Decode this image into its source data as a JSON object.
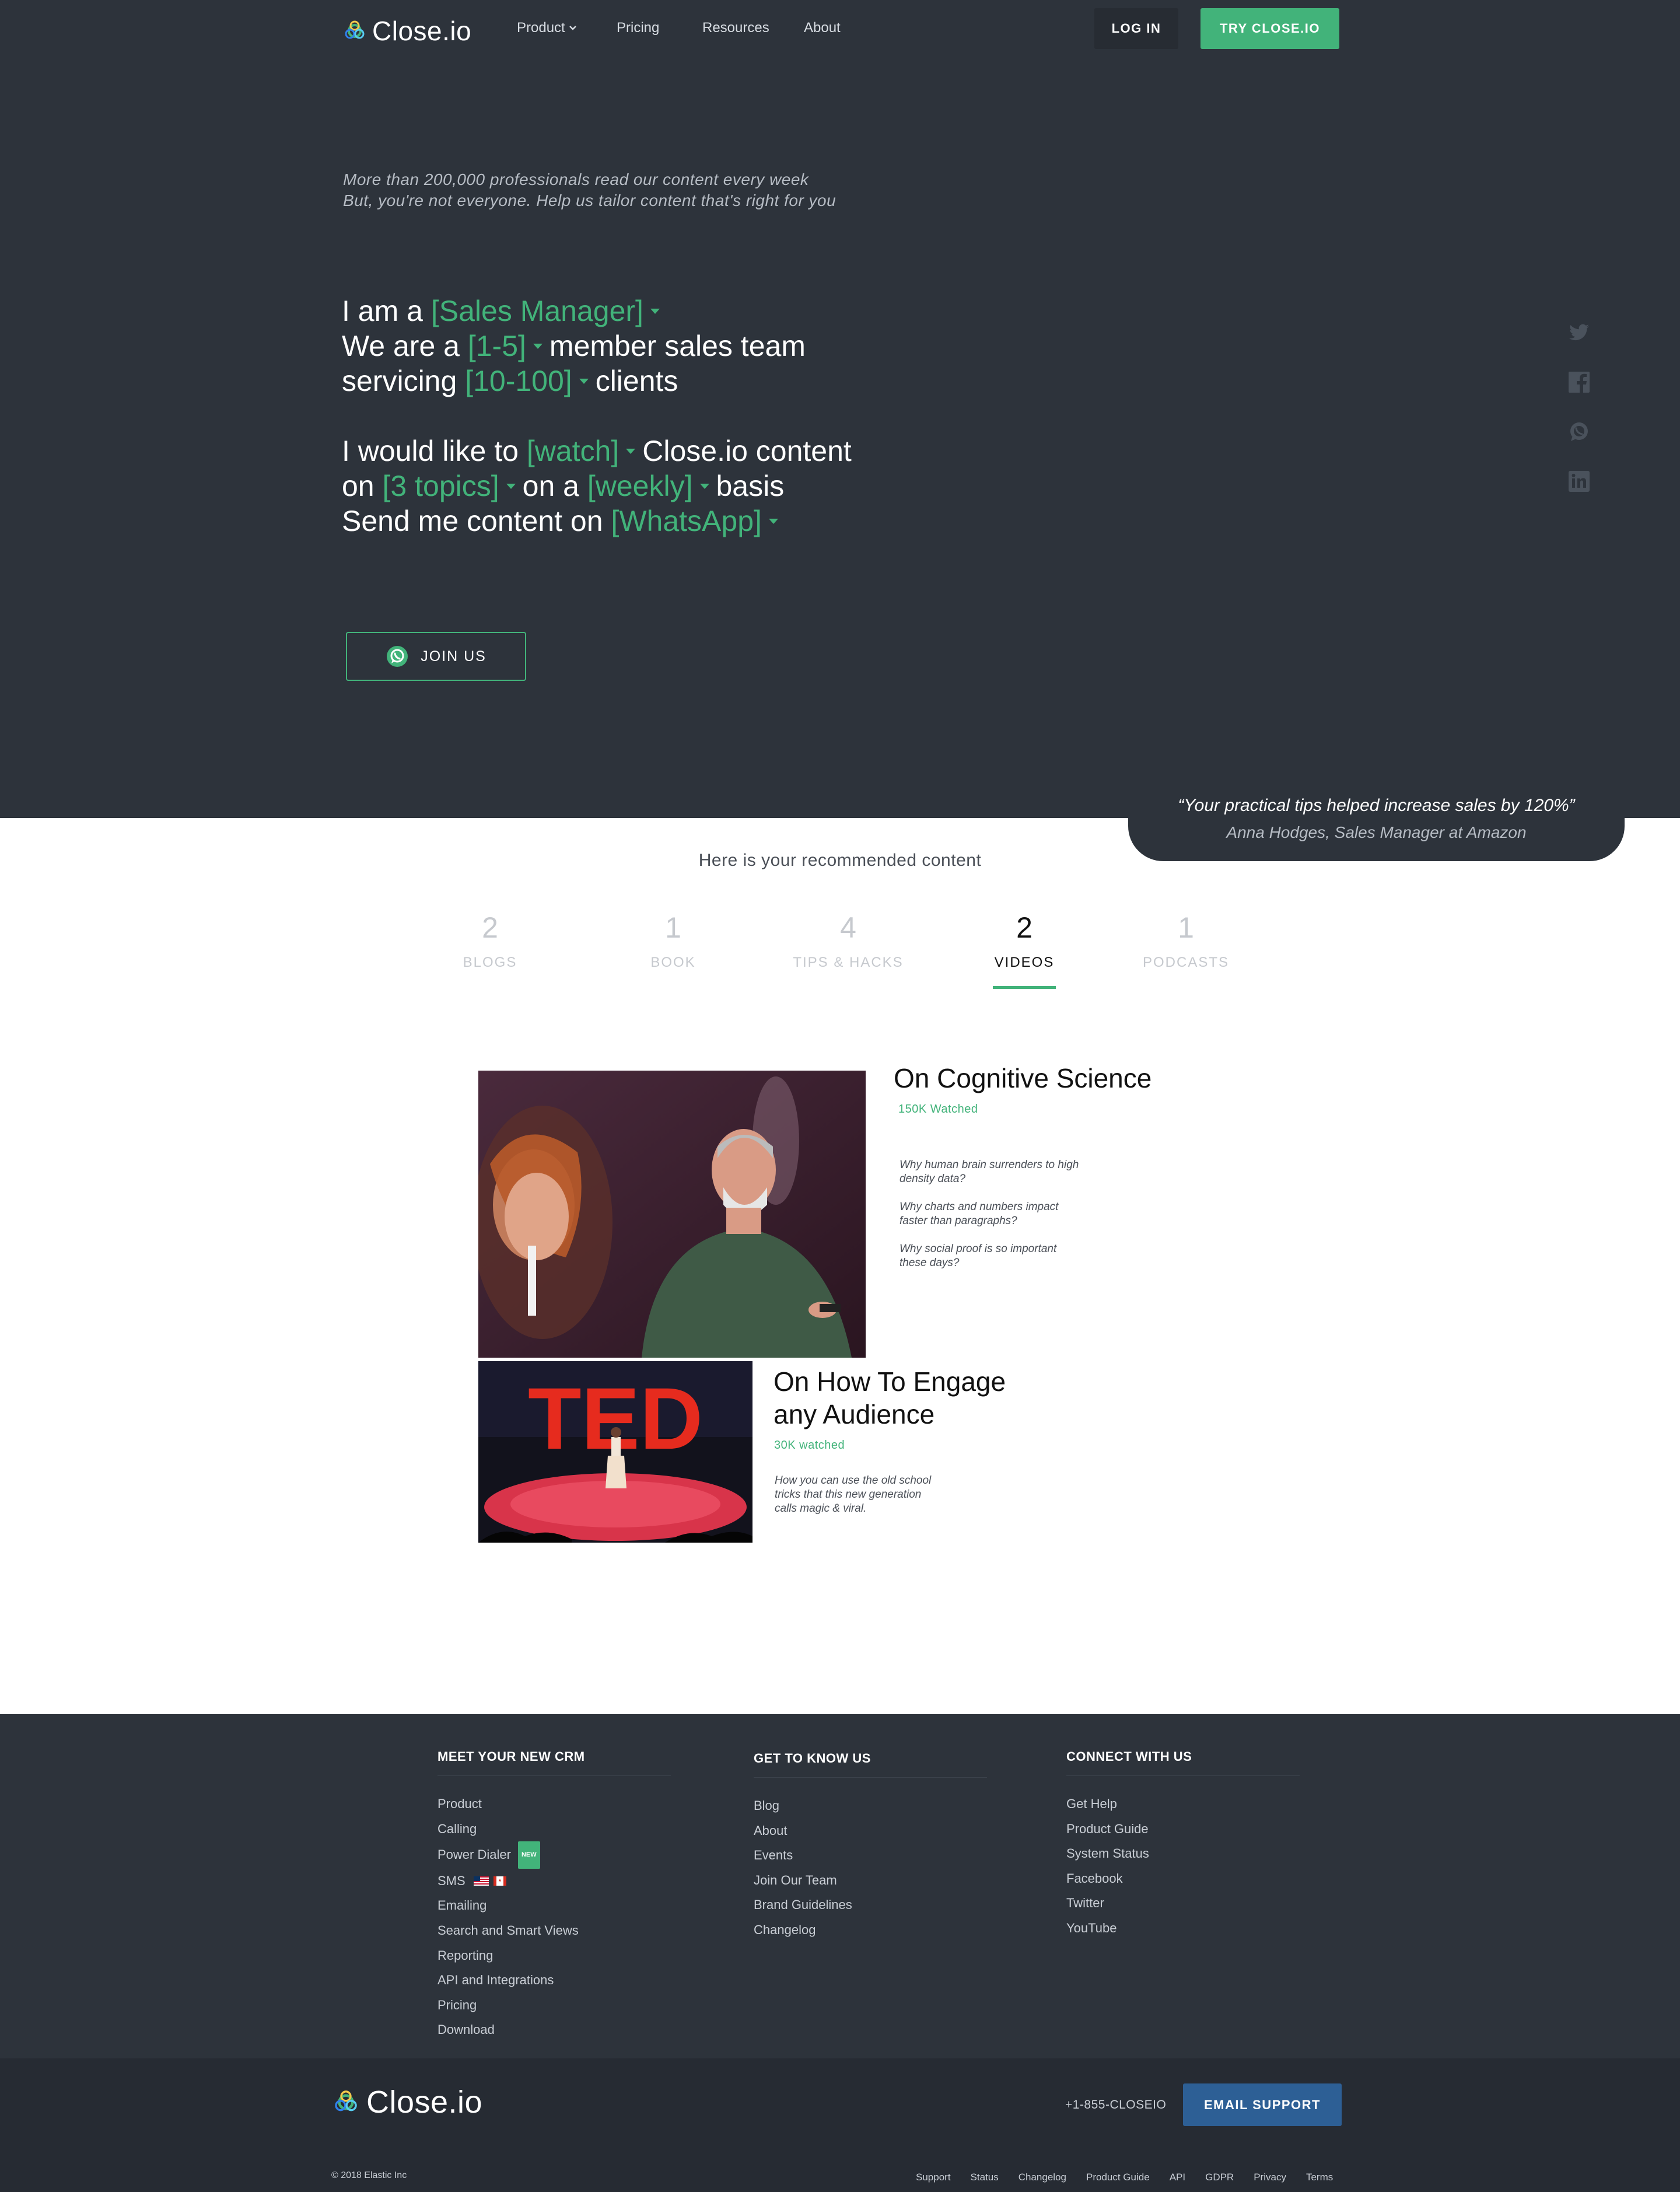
{
  "brand": {
    "name": "Close.io"
  },
  "nav": {
    "links": [
      "Product",
      "Pricing",
      "Resources",
      "About"
    ],
    "login": "LOG IN",
    "try": "TRY CLOSE.IO"
  },
  "hero": {
    "intro_1": "More than 200,000 professionals read our content every week",
    "intro_2": "But, you're not everyone. Help us tailor content that's right for you",
    "sentence": {
      "l1_pre": "I am a",
      "role": "[Sales Manager]",
      "l2_pre": "We are a",
      "team_size": "[1-5]",
      "l2_post": "member sales team",
      "l3_pre": "servicing",
      "clients": "[10-100]",
      "l3_post": "clients",
      "l4_pre": "I would like to",
      "mode": "[watch]",
      "l4_post": "Close.io content",
      "l5_pre": "on",
      "topics": "[3 topics]",
      "l5_mid": "on a",
      "frequency": "[weekly]",
      "l5_post": "basis",
      "l6_pre": "Send me content on",
      "channel": "[WhatsApp]"
    },
    "join_button": "JOIN US",
    "social_icons": [
      "twitter-icon",
      "facebook-icon",
      "whatsapp-icon",
      "linkedin-icon"
    ]
  },
  "testimonial": {
    "quote": "“Your practical tips helped increase sales by 120%”",
    "author": "Anna Hodges, Sales Manager at Amazon"
  },
  "recommended": {
    "title": "Here is your recommended content",
    "tabs": [
      {
        "count": "2",
        "label": "BLOGS"
      },
      {
        "count": "1",
        "label": "BOOK"
      },
      {
        "count": "4",
        "label": "TIPS & HACKS"
      },
      {
        "count": "2",
        "label": "VIDEOS",
        "active": true
      },
      {
        "count": "1",
        "label": "PODCASTS"
      }
    ],
    "videos": [
      {
        "title": "On Cognitive Science",
        "watched": "150K Watched",
        "bullets": [
          [
            "Why human brain surrenders to high",
            "density data?"
          ],
          [
            "Why charts and numbers impact",
            "faster than paragraphs?"
          ],
          [
            "Why social proof is so important",
            "these days?"
          ]
        ]
      },
      {
        "title_1": "On How To Engage",
        "title_2": "any Audience",
        "watched": "30K watched",
        "desc": [
          "How you can use the old school",
          "tricks that this new generation",
          "calls magic & viral."
        ],
        "stage_text": "TED"
      }
    ]
  },
  "footer": {
    "col1": {
      "title": "MEET YOUR NEW CRM",
      "links": [
        "Product",
        "Calling",
        "Power Dialer",
        "SMS",
        "Emailing",
        "Search and Smart Views",
        "Reporting",
        "API and Integrations",
        "Pricing",
        "Download"
      ],
      "new_badge": "NEW"
    },
    "col2": {
      "title": "GET TO KNOW US",
      "links": [
        "Blog",
        "About",
        "Events",
        "Join Our Team",
        "Brand Guidelines",
        "Changelog"
      ]
    },
    "col3": {
      "title": "CONNECT WITH US",
      "links": [
        "Get Help",
        "Product Guide",
        "System Status",
        "Facebook",
        "Twitter",
        "YouTube"
      ]
    },
    "phone": "+1-855-CLOSEIO",
    "email_support": "EMAIL SUPPORT",
    "copyright": "© 2018 Elastic Inc",
    "legal_links": [
      "Support",
      "Status",
      "Changelog",
      "Product Guide",
      "API",
      "GDPR",
      "Privacy",
      "Terms"
    ]
  },
  "colors": {
    "accent": "#42b37a",
    "dark": "#2d333b",
    "darker": "#262b33",
    "email_btn": "#2d5f95"
  }
}
